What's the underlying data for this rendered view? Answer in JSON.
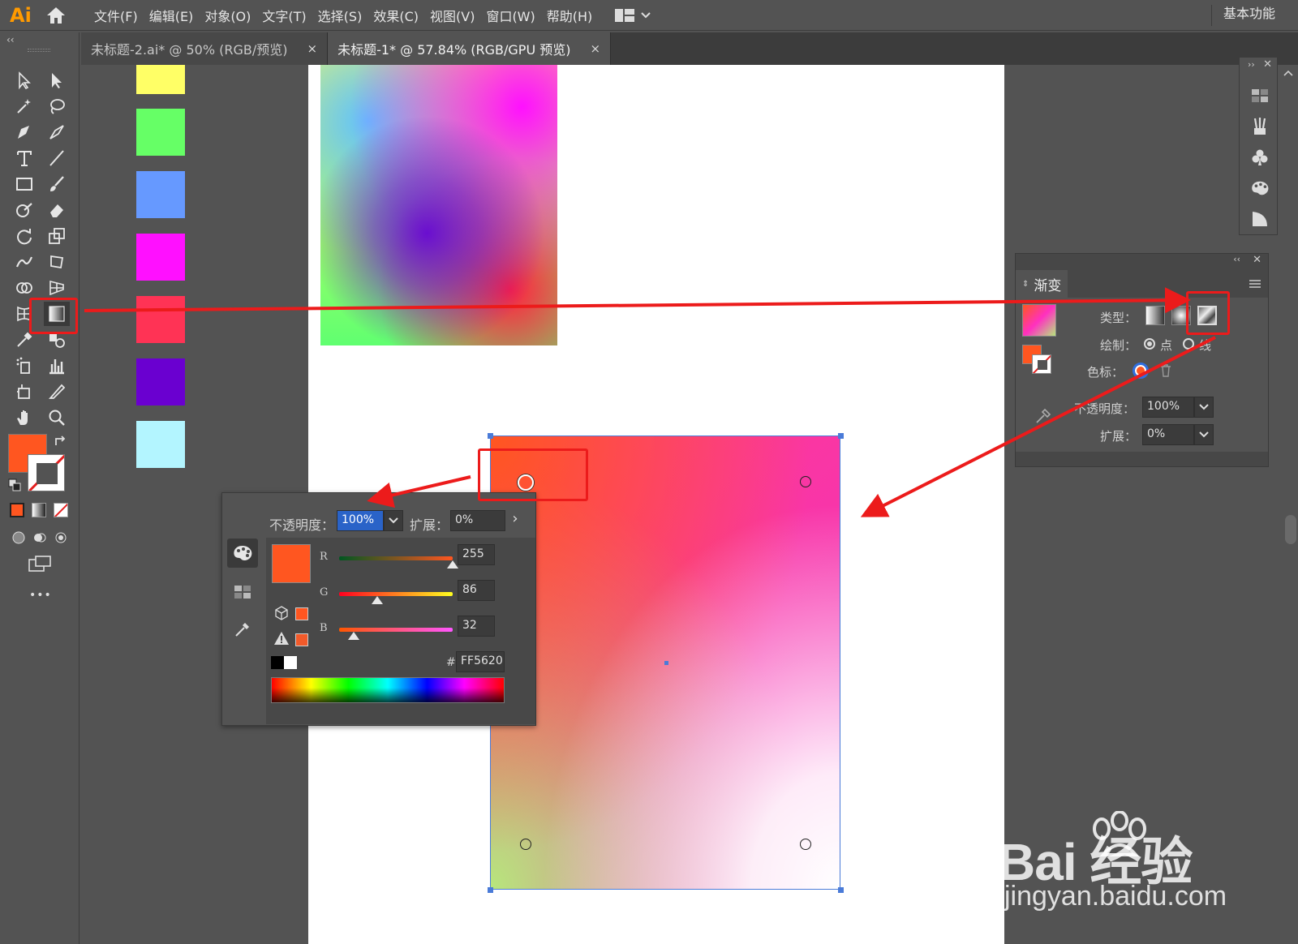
{
  "app": {
    "logo": "Ai",
    "menu": [
      "文件(F)",
      "编辑(E)",
      "对象(O)",
      "文字(T)",
      "选择(S)",
      "效果(C)",
      "视图(V)",
      "窗口(W)",
      "帮助(H)"
    ],
    "workspace": "基本功能"
  },
  "tabs": [
    {
      "label": "未标题-2.ai* @ 50% (RGB/预览)",
      "close": "×",
      "active": false
    },
    {
      "label": "未标题-1* @ 57.84% (RGB/GPU 预览)",
      "close": "×",
      "active": true
    }
  ],
  "toolbar": {
    "collapse": "‹‹",
    "more": "•••",
    "fill_color": "#ff5620",
    "tools": [
      "selection-tool",
      "direct-selection-tool",
      "magic-wand-tool",
      "lasso-tool",
      "pen-tool",
      "curvature-tool",
      "type-tool",
      "line-tool",
      "rectangle-tool",
      "paintbrush-tool",
      "shaper-tool",
      "eraser-tool",
      "rotate-tool",
      "scale-tool",
      "warp-tool",
      "free-transform-tool",
      "shape-builder-tool",
      "perspective-grid-tool",
      "mesh-tool",
      "gradient-tool",
      "eyedropper-tool",
      "blend-tool",
      "symbol-sprayer-tool",
      "column-graph-tool",
      "artboard-tool",
      "slice-tool",
      "hand-tool",
      "zoom-tool"
    ]
  },
  "canvas": {
    "swatches": [
      "#ffff66",
      "#66ff66",
      "#6699ff",
      "#ff10ff",
      "#ff3355",
      "#6a00d0",
      "#b3f5ff"
    ]
  },
  "color_popover": {
    "opacity_label": "不透明度：",
    "opacity_value": "100%",
    "spread_label": "扩展：",
    "spread_value": "0%",
    "more": "›",
    "channels": [
      {
        "name": "R",
        "value": "255",
        "fraction": 1.0
      },
      {
        "name": "G",
        "value": "86",
        "fraction": 0.337
      },
      {
        "name": "B",
        "value": "32",
        "fraction": 0.125
      }
    ],
    "hex_label": "#",
    "hex_value": "FF5620",
    "swatch_color": "#ff5620"
  },
  "gradient_panel": {
    "title": "渐变",
    "type_label": "类型：",
    "draw_label": "绘制：",
    "draw_point": "点",
    "draw_line": "线",
    "stop_label": "色标：",
    "opacity_label": "不透明度：",
    "opacity_value": "100%",
    "spread_label": "扩展：",
    "spread_value": "0%"
  },
  "watermark": {
    "brand": "Bai 经验",
    "url": "jingyan.baidu.com"
  }
}
